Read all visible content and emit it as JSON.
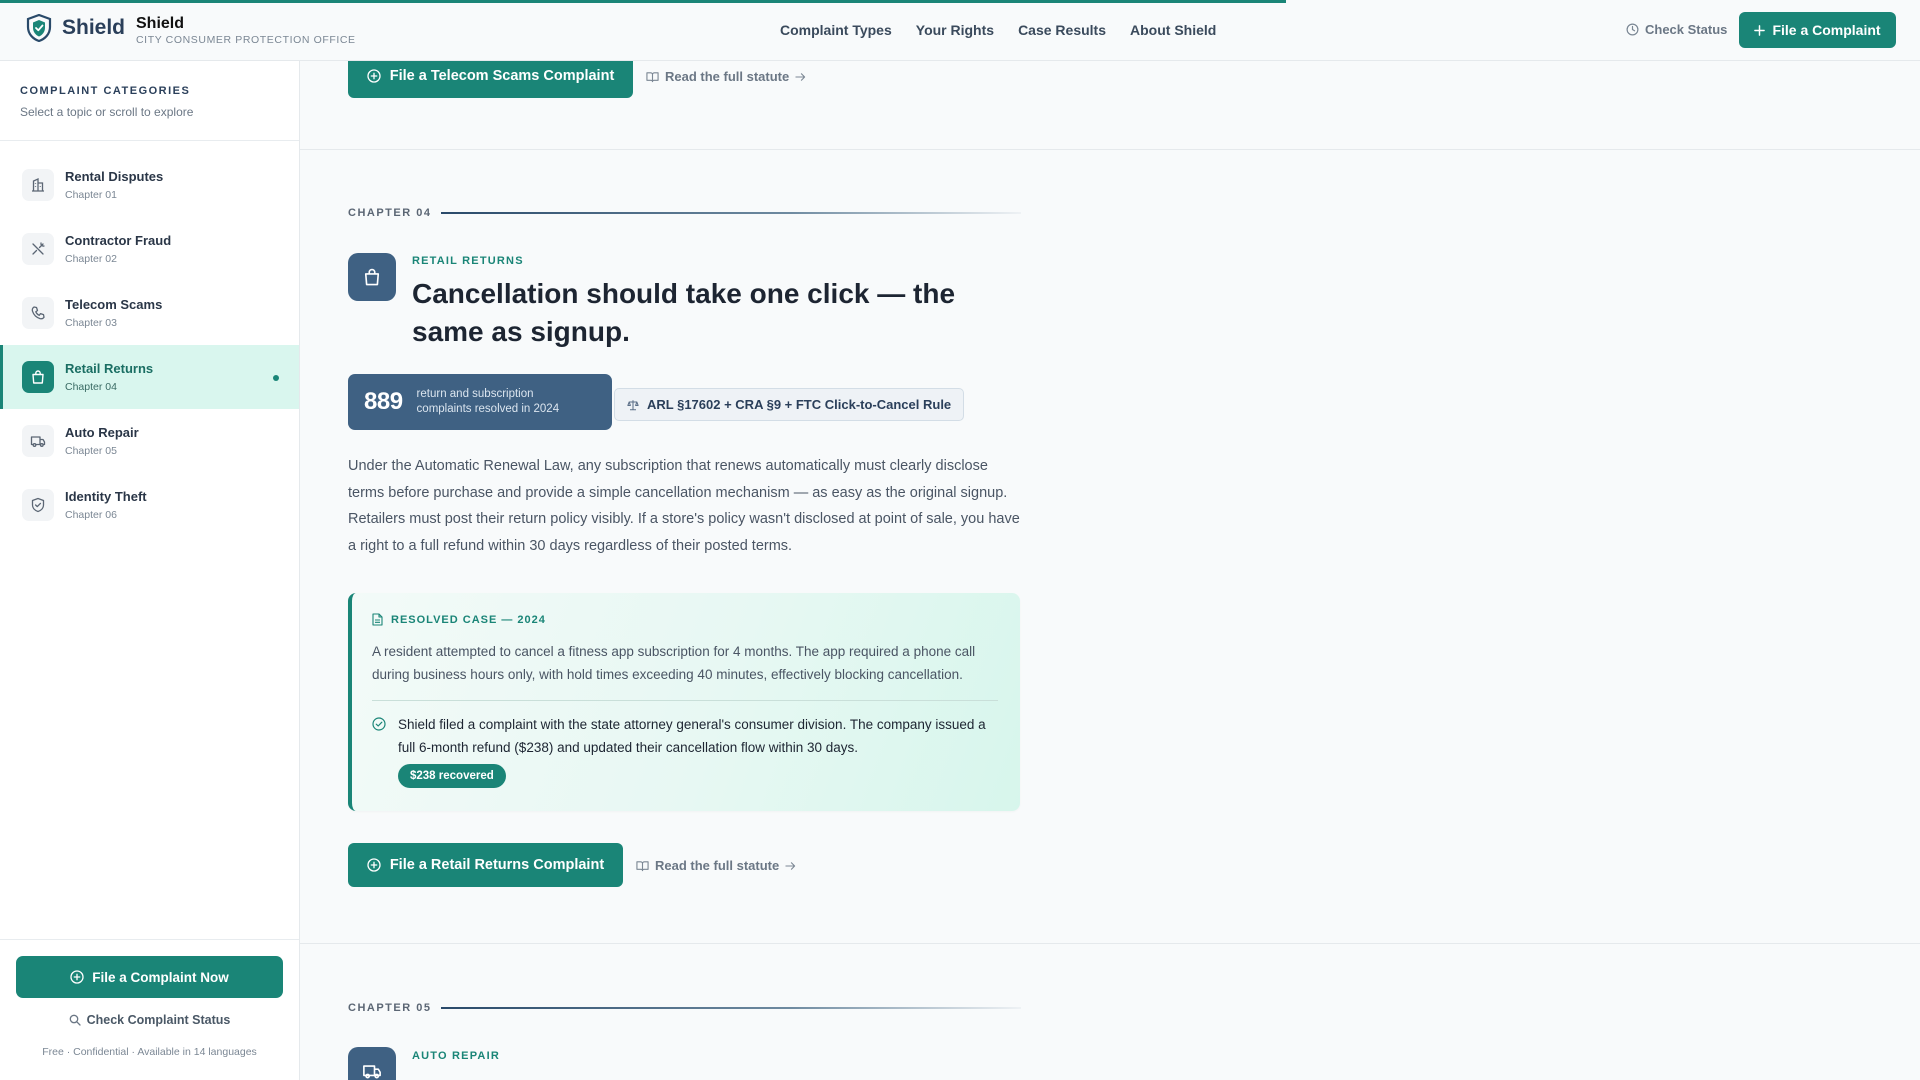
{
  "header": {
    "brand_name": "Shield",
    "brand_title": "Shield",
    "brand_subtitle": "CITY CONSUMER PROTECTION OFFICE",
    "nav": [
      "Complaint Types",
      "Your Rights",
      "Case Results",
      "About Shield"
    ],
    "check_status": "Check Status",
    "file_complaint": "File a Complaint",
    "scroll_progress": 0.67
  },
  "sidebar": {
    "heading": "COMPLAINT CATEGORIES",
    "subheading": "Select a topic or scroll to explore",
    "items": [
      {
        "label": "Rental Disputes",
        "chapter": "Chapter 01",
        "icon": "building-icon"
      },
      {
        "label": "Contractor Fraud",
        "chapter": "Chapter 02",
        "icon": "tools-icon"
      },
      {
        "label": "Telecom Scams",
        "chapter": "Chapter 03",
        "icon": "phone-icon"
      },
      {
        "label": "Retail Returns",
        "chapter": "Chapter 04",
        "icon": "shopping-bag-icon",
        "active": true
      },
      {
        "label": "Auto Repair",
        "chapter": "Chapter 05",
        "icon": "truck-icon"
      },
      {
        "label": "Identity Theft",
        "chapter": "Chapter 06",
        "icon": "shield-check-icon"
      }
    ],
    "cta": "File a Complaint Now",
    "check": "Check Complaint Status",
    "note": "Free · Confidential · Available in 14 languages"
  },
  "prev_section": {
    "cta": "File a Telecom Scams Complaint",
    "statute_link": "Read the full statute"
  },
  "section": {
    "chapter": "CHAPTER 04",
    "eyebrow": "RETAIL RETURNS",
    "title": "Cancellation should take one click — the same as signup.",
    "stat_number": "889",
    "stat_text": "return and subscription complaints resolved in 2024",
    "law_tag": "ARL §17602 + CRA §9 + FTC Click-to-Cancel Rule",
    "body": "Under the Automatic Renewal Law, any subscription that renews automatically must clearly disclose terms before purchase and provide a simple cancellation mechanism — as easy as the original signup. Retailers must post their return policy visibly. If a store's policy wasn't disclosed at point of sale, you have a right to a full refund within 30 days regardless of their posted terms.",
    "case": {
      "heading": "RESOLVED CASE — 2024",
      "description": "A resident attempted to cancel a fitness app subscription for 4 months. The app required a phone call during business hours only, with hold times exceeding 40 minutes, effectively blocking cancellation.",
      "resolution": "Shield filed a complaint with the state attorney general's consumer division. The company issued a full 6-month refund ($238) and updated their cancellation flow within 30 days.",
      "badge": "$238 recovered"
    },
    "cta": "File a Retail Returns Complaint",
    "statute_link": "Read the full statute"
  },
  "next_section": {
    "chapter": "CHAPTER 05",
    "eyebrow": "AUTO REPAIR"
  },
  "colors": {
    "accent": "#1a8577",
    "navy": "#3f6183",
    "active_bg": "#d9f6ee"
  }
}
